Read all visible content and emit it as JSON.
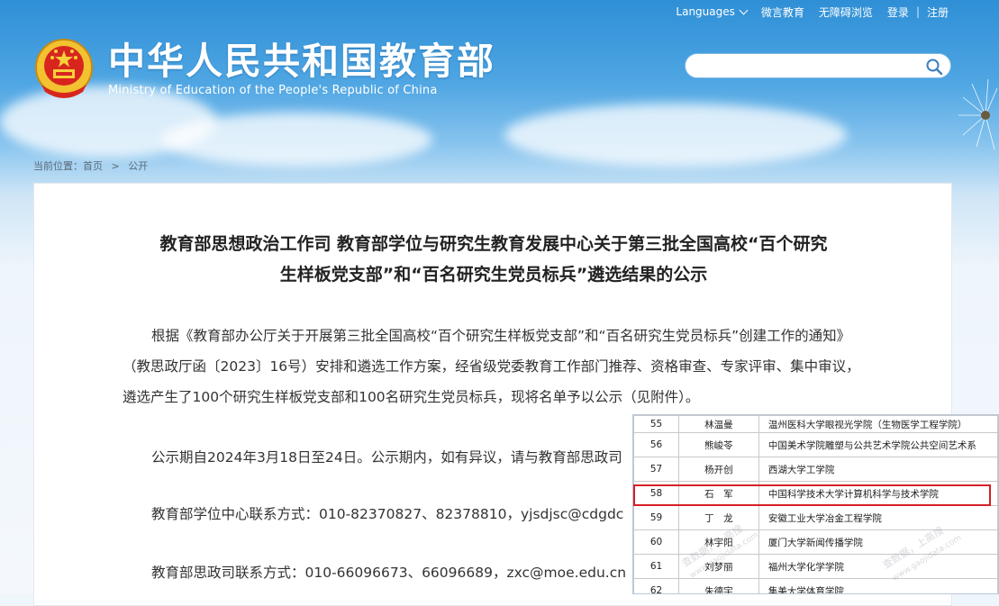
{
  "header": {
    "title_cn": "中华人民共和国教育部",
    "title_en": "Ministry of Education of the People's Republic of China",
    "nav": {
      "languages": "Languages",
      "wechat": "微言教育",
      "accessibility": "无障碍浏览",
      "login": "登录",
      "register": "注册",
      "separator": "|"
    },
    "search_placeholder": ""
  },
  "breadcrumb": {
    "label": "当前位置：",
    "home": "首页",
    "separator": ">",
    "current": "公开"
  },
  "article": {
    "headline_line1": "教育部思想政治工作司 教育部学位与研究生教育发展中心关于第三批全国高校“百个研究",
    "headline_line2": "生样板党支部”和“百名研究生党员标兵”遴选结果的公示",
    "paragraph1": "根据《教育部办公厅关于开展第三批全国高校“百个研究生样板党支部”和“百名研究生党员标兵”创建工作的通知》（教思政厅函〔2023〕16号）安排和遴选工作方案，经省级党委教育工作部门推荐、资格审查、专家评审、集中审议，遴选产生了100个研究生样板党支部和100名研究生党员标兵，现将名单予以公示（见附件）。",
    "paragraph2": "公示期自2024年3月18日至24日。公示期内，如有异议，请与教育部思政司",
    "paragraph3": "教育部学位中心联系方式：010-82370827、82378810，yjsdjsc@cdgdc",
    "paragraph4": "教育部思政司联系方式：010-66096673、66096689，zxc@moe.edu.cn"
  },
  "table": {
    "rows": [
      {
        "num": "55",
        "name": "林温曼",
        "school": "温州医科大学眼视光学院（生物医学工程学院）"
      },
      {
        "num": "56",
        "name": "熊峻苓",
        "school": "中国美术学院雕塑与公共艺术学院公共空间艺术系"
      },
      {
        "num": "57",
        "name": "杨开创",
        "school": "西湖大学工学院"
      },
      {
        "num": "58",
        "name": "石　军",
        "school": "中国科学技术大学计算机科学与技术学院"
      },
      {
        "num": "59",
        "name": "丁　龙",
        "school": "安徽工业大学冶金工程学院"
      },
      {
        "num": "60",
        "name": "林宇阳",
        "school": "厦门大学新闻传播学院"
      },
      {
        "num": "61",
        "name": "刘梦丽",
        "school": "福州大学化学学院"
      },
      {
        "num": "62",
        "name": "朱德宇",
        "school": "集美大学体育学院"
      }
    ],
    "highlighted_row": 3
  },
  "watermark": {
    "text1": "查数据，上高搜",
    "text2": "www.gaojidata.com"
  },
  "colors": {
    "highlight_border": "#d61f26",
    "header_blue": "#2f8fd6"
  }
}
